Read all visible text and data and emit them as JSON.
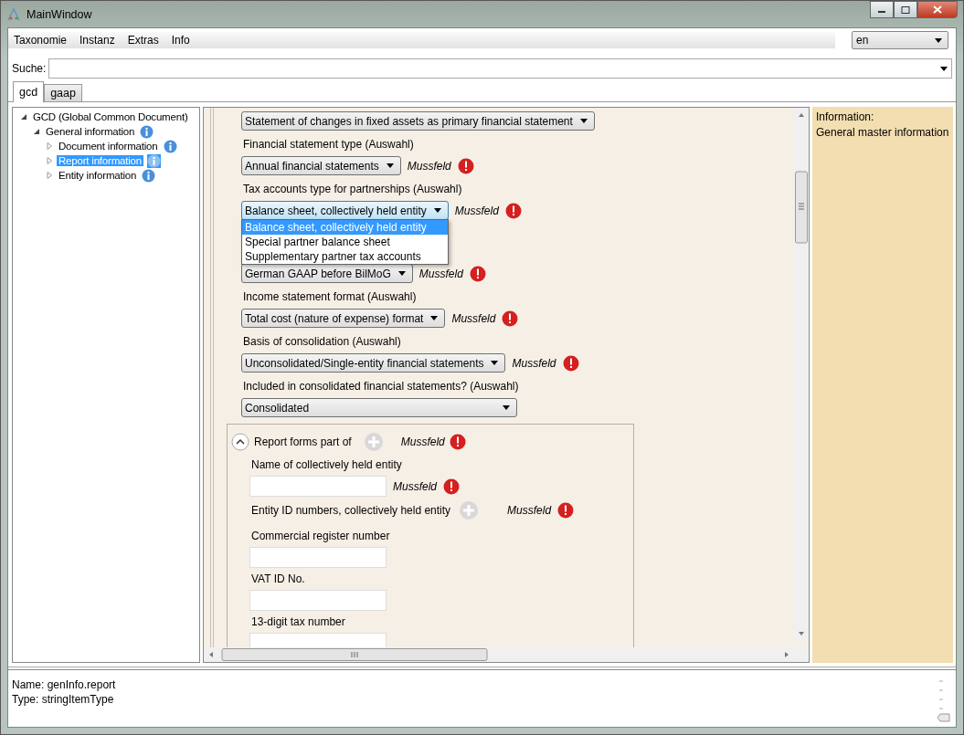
{
  "window": {
    "title": "MainWindow"
  },
  "menu": [
    "Taxonomie",
    "Instanz",
    "Extras",
    "Info"
  ],
  "language": {
    "value": "en"
  },
  "search": {
    "label": "Suche:"
  },
  "tabs": [
    {
      "label": "gcd",
      "selected": true
    },
    {
      "label": "gaap",
      "selected": false
    }
  ],
  "tree": [
    {
      "label": "GCD (Global Common Document)",
      "expanded": true,
      "info": false,
      "selected": false,
      "children": [
        {
          "label": "General information",
          "expanded": true,
          "info": true,
          "selected": false,
          "children": [
            {
              "label": "Document information",
              "expanded": false,
              "info": true,
              "selected": false
            },
            {
              "label": "Report information",
              "expanded": false,
              "info": true,
              "selected": true
            },
            {
              "label": "Entity information",
              "expanded": false,
              "info": true,
              "selected": false
            }
          ]
        }
      ]
    }
  ],
  "form": {
    "fields": [
      {
        "kind": "combo",
        "value": "Statement of changes in fixed assets as primary financial statement",
        "required": false,
        "open": false,
        "wide": false
      },
      {
        "kind": "combo",
        "label": "Financial statement type (Auswahl)",
        "value": "Annual financial statements",
        "required": true,
        "note": "Mussfeld",
        "open": false,
        "wide": false
      },
      {
        "kind": "combo",
        "label": "Tax accounts type for partnerships (Auswahl)",
        "value": "Balance sheet, collectively held entity",
        "required": true,
        "note": "Mussfeld",
        "open": true,
        "wide": false,
        "options": [
          {
            "label": "Balance sheet, collectively held entity",
            "selected": true
          },
          {
            "label": "Special partner balance sheet",
            "selected": false
          },
          {
            "label": "Supplementary partner tax accounts",
            "selected": false
          }
        ]
      },
      {
        "kind": "combo",
        "value": "German GAAP before BilMoG",
        "required": true,
        "note": "Mussfeld",
        "open": false,
        "wide": false
      },
      {
        "kind": "combo",
        "label": "Income statement format (Auswahl)",
        "value": "Total cost (nature of expense) format",
        "required": true,
        "note": "Mussfeld",
        "open": false,
        "wide": false
      },
      {
        "kind": "combo",
        "label": "Basis of consolidation (Auswahl)",
        "value": "Unconsolidated/Single-entity financial statements",
        "required": true,
        "note": "Mussfeld",
        "open": false,
        "wide": false
      },
      {
        "kind": "combo",
        "label": "Included in consolidated financial statements? (Auswahl)",
        "value": "Consolidated",
        "required": false,
        "open": false,
        "wide": true
      }
    ],
    "group": {
      "title": "Report forms part of",
      "expanded": true,
      "note": "Mussfeld",
      "required": true,
      "items": [
        {
          "kind": "text",
          "label": "Name of collectively held entity",
          "required": true,
          "note": "Mussfeld"
        },
        {
          "kind": "header",
          "label": "Entity ID numbers, collectively held entity",
          "required": true,
          "note": "Mussfeld"
        },
        {
          "kind": "text",
          "label": "Commercial register number",
          "required": false
        },
        {
          "kind": "text",
          "label": "VAT ID No.",
          "required": false
        },
        {
          "kind": "text",
          "label": "13-digit tax number",
          "required": false
        }
      ]
    }
  },
  "info_panel": {
    "heading": "Information:",
    "text": "General master information"
  },
  "details": [
    "Name: genInfo.report",
    "Type: stringItemType"
  ]
}
